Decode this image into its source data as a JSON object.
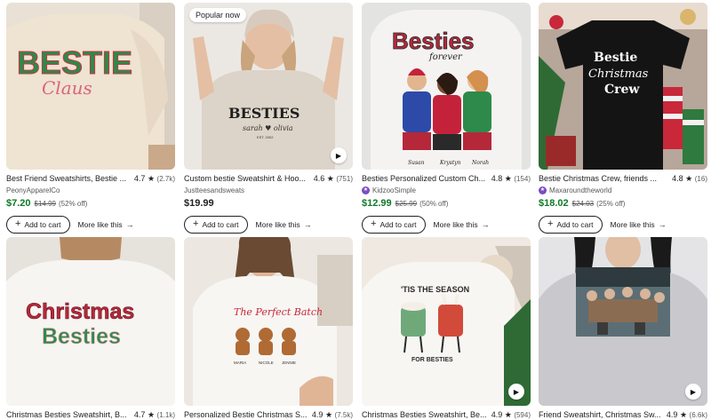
{
  "listings": [
    {
      "title": "Best Friend Sweatshirts, Bestie ...",
      "rating": "4.7",
      "reviews": "(2.7k)",
      "shop": "PeonyApparelCo",
      "star_seller": false,
      "price": "$7.20",
      "original_price": "$14.99",
      "discount": "(52% off)",
      "badge": "",
      "has_video": false,
      "image_text": [
        "BESTIE",
        "Claus"
      ]
    },
    {
      "title": "Custom bestie Sweatshirt & Hoo...",
      "rating": "4.6",
      "reviews": "(751)",
      "shop": "Justteesandsweats",
      "star_seller": false,
      "price": "$19.99",
      "original_price": "",
      "discount": "",
      "badge": "Popular now",
      "has_video": true,
      "image_text": [
        "BESTIES",
        "sarah ♥ olivia",
        "EST. 2002"
      ]
    },
    {
      "title": "Besties Personalized Custom Ch...",
      "rating": "4.8",
      "reviews": "(154)",
      "shop": "KidzooSimple",
      "star_seller": true,
      "price": "$12.99",
      "original_price": "$25.99",
      "discount": "(50% off)",
      "badge": "",
      "has_video": false,
      "image_text": [
        "Besties",
        "forever",
        "Susan",
        "Krystyn",
        "Norah"
      ]
    },
    {
      "title": "Bestie Christmas Crew, friends ...",
      "rating": "4.8",
      "reviews": "(16)",
      "shop": "Maxaroundtheworld",
      "star_seller": true,
      "price": "$18.02",
      "original_price": "$24.03",
      "discount": "(25% off)",
      "badge": "",
      "has_video": false,
      "image_text": [
        "Bestie",
        "Christmas",
        "Crew"
      ]
    },
    {
      "title": "Christmas Besties Sweatshirt, B...",
      "rating": "4.7",
      "reviews": "(1.1k)",
      "badge": "",
      "has_video": false,
      "image_text": [
        "Christmas",
        "Besties"
      ]
    },
    {
      "title": "Personalized Bestie Christmas S...",
      "rating": "4.9",
      "reviews": "(7.5k)",
      "badge": "",
      "has_video": false,
      "image_text": [
        "The Perfect Batch",
        "MARIA",
        "NICOLE",
        "JENNIE"
      ]
    },
    {
      "title": "Christmas Besties Sweatshirt, Be...",
      "rating": "4.9",
      "reviews": "(594)",
      "badge": "",
      "has_video": true,
      "image_text": [
        "'TIS THE SEASON",
        "FOR BESTIES"
      ]
    },
    {
      "title": "Friend Sweatshirt, Christmas Sw...",
      "rating": "4.9",
      "reviews": "(6.6k)",
      "badge": "",
      "has_video": true,
      "image_text": []
    }
  ],
  "labels": {
    "add_to_cart": "Add to cart",
    "more_like_this": "More like this"
  },
  "colors": {
    "sale_price": "#0e7a26",
    "text": "#222222",
    "muted": "#595959",
    "star_seller_badge": "#7a4cc2"
  },
  "icons": {
    "star": "star-icon",
    "play": "play-icon",
    "plus": "plus-icon",
    "arrow": "arrow-right-icon",
    "star_seller": "star-seller-icon"
  }
}
